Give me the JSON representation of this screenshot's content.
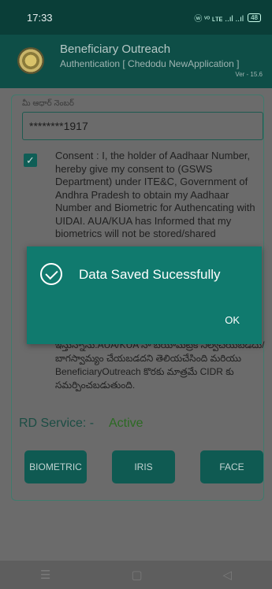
{
  "status": {
    "time": "17:33",
    "icons": "ⓦ ᵛᵒ ʟᴛᴇ ..ıl ..ıl",
    "battery": "48"
  },
  "app": {
    "title": "Beneficiary Outreach",
    "subtitle": "Authentication [ Chedodu NewApplication ]",
    "version": "Ver - 15.6"
  },
  "form": {
    "aadhaar_label": "మీ ఆధార్ నెంబర్",
    "aadhaar_value": "********1917",
    "consent_checked": true,
    "consent_en": "Consent : I, the holder of Aadhaar Number, hereby give my consent to (GSWS Department) under ITE&C, Government of Andhra Pradesh to obtain my Aadhaar Number and Biometric for Authencating with UIDAI. AUA/KUA has Informed that my biometrics will not be stored/shared",
    "consent_te": "ఇస్తున్నాను.AUA/KUA నా బయోమెట్రిక్ నిల్వచేయబడదు/బాగస్వామ్యం చేయబడదని తెలియచేసింది మరియు BeneficiaryOutreach కొరకు మాత్రమే CIDR కు సమర్పించబడుతుంది."
  },
  "rd_service": {
    "label": "RD Service: -",
    "value": "Active",
    "value_color": "#2c6a23"
  },
  "buttons": {
    "biometric": "BIOMETRIC",
    "iris": "IRIS",
    "face": "FACE"
  },
  "dialog": {
    "message": "Data Saved Sucessfully",
    "ok": "OK",
    "icon": "check-circle-icon"
  },
  "nav": {
    "menu": "☰",
    "home": "▢",
    "back": "◁"
  },
  "colors": {
    "primary": "#0e4e47",
    "dialog": "#107a6e"
  }
}
